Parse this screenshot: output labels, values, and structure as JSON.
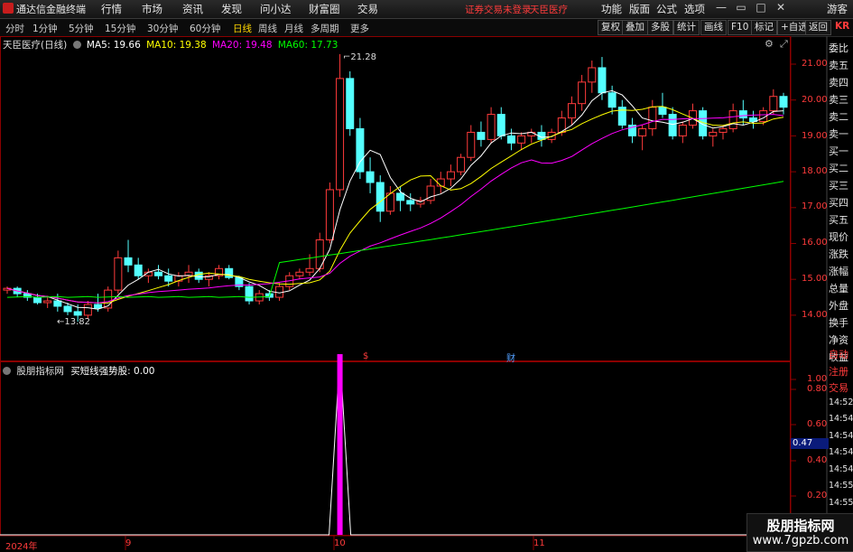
{
  "app": {
    "title": "通达信金融终端"
  },
  "menus": [
    "行情",
    "市场",
    "资讯",
    "发现",
    "问小达",
    "财富圈",
    "交易"
  ],
  "status": {
    "login": "证券交易未登录",
    "stock": "天臣医疗"
  },
  "right_menus": [
    "功能",
    "版面",
    "公式",
    "选项"
  ],
  "guest": "游客",
  "periods": [
    "分时",
    "1分钟",
    "5分钟",
    "15分钟",
    "30分钟",
    "60分钟",
    "日线",
    "周线",
    "月线",
    "多周期",
    "更多"
  ],
  "tools": [
    "复权",
    "叠加",
    "多股",
    "统计",
    "画线",
    "F10",
    "标记",
    "+自选",
    "返回"
  ],
  "krx": "KR",
  "main_legend": {
    "stock": "天臣医疗(日线)",
    "ma5": "MA5: 19.66",
    "ma10": "MA10: 19.38",
    "ma20": "MA20: 19.48",
    "ma60": "MA60: 17.73"
  },
  "indicator_legend": {
    "name": "股朋指标网",
    "series": "买短线强势股: 0.00"
  },
  "price_axis": [
    "21.00",
    "20.00",
    "19.00",
    "18.00",
    "17.00",
    "16.00",
    "15.00",
    "14.00"
  ],
  "indicator_axis": [
    "1.00",
    "0.80",
    "0.60",
    "0.40",
    "0.20"
  ],
  "indicator_current": "0.47",
  "price_annotations": {
    "high": "21.28",
    "low": "13.82"
  },
  "event_markers": {
    "s": "$",
    "cai": "财"
  },
  "date_axis": [
    "2024年",
    "9",
    "10",
    "11"
  ],
  "right_panel": [
    "委比",
    "卖五",
    "卖四",
    "卖三",
    "卖二",
    "卖一",
    "买一",
    "买二",
    "买三",
    "买四",
    "买五",
    "现价",
    "涨跌",
    "涨幅",
    "总量",
    "外盘",
    "换手",
    "净资",
    "收益"
  ],
  "right_panel2": [
    "自动",
    "注册",
    "交易",
    "14:52",
    "14:54",
    "14:54",
    "14:54",
    "14:54",
    "14:55",
    "14:55",
    "14:55",
    "14:55"
  ],
  "watermark": {
    "line1": "股朋指标网",
    "line2": "www.7gpzb.com"
  },
  "colors": {
    "up": "#ff3b3b",
    "down": "#54ffff",
    "ma5": "#ffffff",
    "ma10": "#ffff00",
    "ma20": "#ff00ff",
    "ma60": "#00ff00",
    "indicator": "#ff00ff"
  },
  "chart_data": {
    "type": "candlestick",
    "title": "天臣医疗(日线)",
    "ylim": [
      13.6,
      21.8
    ],
    "candles": [
      [
        14.7,
        14.8,
        14.6,
        14.75
      ],
      [
        14.75,
        14.8,
        14.5,
        14.6
      ],
      [
        14.6,
        14.7,
        14.4,
        14.5
      ],
      [
        14.5,
        14.6,
        14.3,
        14.35
      ],
      [
        14.35,
        14.5,
        14.2,
        14.4
      ],
      [
        14.4,
        14.6,
        14.1,
        14.25
      ],
      [
        14.25,
        14.35,
        14.0,
        14.1
      ],
      [
        14.1,
        14.3,
        13.82,
        14.0
      ],
      [
        14.0,
        14.4,
        13.9,
        14.3
      ],
      [
        14.3,
        14.6,
        14.1,
        14.2
      ],
      [
        14.2,
        14.8,
        14.1,
        14.7
      ],
      [
        14.7,
        15.8,
        14.6,
        15.6
      ],
      [
        15.6,
        16.1,
        15.2,
        15.4
      ],
      [
        15.4,
        15.6,
        15.0,
        15.1
      ],
      [
        15.1,
        15.3,
        14.9,
        15.2
      ],
      [
        15.2,
        15.4,
        15.0,
        15.1
      ],
      [
        15.1,
        15.3,
        14.8,
        14.95
      ],
      [
        14.95,
        15.2,
        14.8,
        15.1
      ],
      [
        15.1,
        15.4,
        14.9,
        15.2
      ],
      [
        15.2,
        15.3,
        14.9,
        15.0
      ],
      [
        15.0,
        15.2,
        14.8,
        15.1
      ],
      [
        15.1,
        15.4,
        15.0,
        15.3
      ],
      [
        15.3,
        15.4,
        15.0,
        15.05
      ],
      [
        15.05,
        15.1,
        14.7,
        14.8
      ],
      [
        14.8,
        14.9,
        14.3,
        14.4
      ],
      [
        14.4,
        14.7,
        14.3,
        14.6
      ],
      [
        14.6,
        14.7,
        14.4,
        14.5
      ],
      [
        14.5,
        14.9,
        14.4,
        14.8
      ],
      [
        14.8,
        15.2,
        14.7,
        15.1
      ],
      [
        15.1,
        15.3,
        15.0,
        15.2
      ],
      [
        15.2,
        15.7,
        15.1,
        15.3
      ],
      [
        15.3,
        16.3,
        15.2,
        16.1
      ],
      [
        16.1,
        17.7,
        16.0,
        17.5
      ],
      [
        17.5,
        21.28,
        17.3,
        20.6
      ],
      [
        20.6,
        20.8,
        19.0,
        19.2
      ],
      [
        19.2,
        19.5,
        17.8,
        18.0
      ],
      [
        18.0,
        18.4,
        17.4,
        17.7
      ],
      [
        17.7,
        17.9,
        16.6,
        16.9
      ],
      [
        16.9,
        17.6,
        16.8,
        17.4
      ],
      [
        17.4,
        17.6,
        16.9,
        17.2
      ],
      [
        17.2,
        17.4,
        16.9,
        17.1
      ],
      [
        17.1,
        17.3,
        17.0,
        17.2
      ],
      [
        17.2,
        17.8,
        17.1,
        17.6
      ],
      [
        17.6,
        18.0,
        17.4,
        17.8
      ],
      [
        17.8,
        18.2,
        17.6,
        18.0
      ],
      [
        18.0,
        18.5,
        17.9,
        18.4
      ],
      [
        18.4,
        19.3,
        18.3,
        19.1
      ],
      [
        19.1,
        19.4,
        18.7,
        18.9
      ],
      [
        18.9,
        19.8,
        18.8,
        19.6
      ],
      [
        19.6,
        19.8,
        18.9,
        19.0
      ],
      [
        19.0,
        19.2,
        18.6,
        18.8
      ],
      [
        18.8,
        19.1,
        18.6,
        19.0
      ],
      [
        19.0,
        19.2,
        18.8,
        19.1
      ],
      [
        19.1,
        19.3,
        18.7,
        18.9
      ],
      [
        18.9,
        19.2,
        18.8,
        19.1
      ],
      [
        19.1,
        19.7,
        19.0,
        19.5
      ],
      [
        19.5,
        20.1,
        19.3,
        19.9
      ],
      [
        19.9,
        20.7,
        19.7,
        20.5
      ],
      [
        20.5,
        21.1,
        20.2,
        20.9
      ],
      [
        20.9,
        21.2,
        20.0,
        20.2
      ],
      [
        20.2,
        20.4,
        19.6,
        19.8
      ],
      [
        19.8,
        20.0,
        19.2,
        19.3
      ],
      [
        19.3,
        19.5,
        18.8,
        19.0
      ],
      [
        19.0,
        19.3,
        18.6,
        19.2
      ],
      [
        19.2,
        20.0,
        19.0,
        19.8
      ],
      [
        19.8,
        20.2,
        19.5,
        19.6
      ],
      [
        19.6,
        19.8,
        18.9,
        19.0
      ],
      [
        19.0,
        19.4,
        18.8,
        19.3
      ],
      [
        19.3,
        19.9,
        19.2,
        19.7
      ],
      [
        19.7,
        19.8,
        18.9,
        19.0
      ],
      [
        19.0,
        19.2,
        18.7,
        19.1
      ],
      [
        19.1,
        19.3,
        18.9,
        19.2
      ],
      [
        19.2,
        19.9,
        19.1,
        19.7
      ],
      [
        19.7,
        20.0,
        19.3,
        19.5
      ],
      [
        19.5,
        19.7,
        19.2,
        19.4
      ],
      [
        19.4,
        19.8,
        19.3,
        19.7
      ],
      [
        19.7,
        20.3,
        19.6,
        20.1
      ],
      [
        20.1,
        20.2,
        19.6,
        19.8
      ]
    ],
    "ma60_start": 14.5,
    "ma60_end": 17.73,
    "indicator_signal_index": 33
  }
}
